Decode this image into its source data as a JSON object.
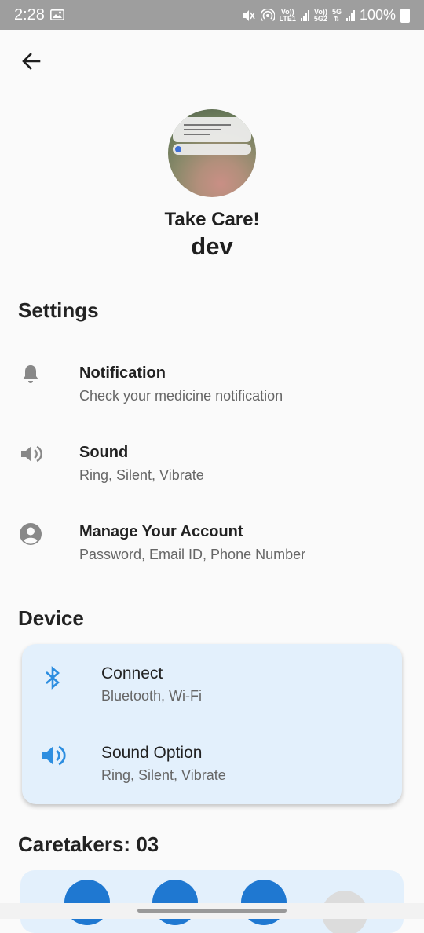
{
  "status_bar": {
    "time": "2:28",
    "volte1": "Vo))",
    "lte1": "LTE1",
    "volte2": "Vo))",
    "lte2": "5G2",
    "net": "5G",
    "battery": "100%"
  },
  "header": {
    "greeting": "Take Care!",
    "username": "dev"
  },
  "settings": {
    "heading": "Settings",
    "items": [
      {
        "label": "Notification",
        "sub": "Check your medicine notification",
        "icon": "bell-icon"
      },
      {
        "label": "Sound",
        "sub": "Ring, Silent, Vibrate",
        "icon": "speaker-icon"
      },
      {
        "label": "Manage Your Account",
        "sub": "Password, Email ID, Phone Number",
        "icon": "account-circle-icon"
      }
    ]
  },
  "device": {
    "heading": "Device",
    "items": [
      {
        "label": "Connect",
        "sub": "Bluetooth, Wi-Fi",
        "icon": "bluetooth-icon"
      },
      {
        "label": "Sound Option",
        "sub": "Ring, Silent, Vibrate",
        "icon": "speaker-icon"
      }
    ]
  },
  "caretakers": {
    "heading": "Caretakers: 03"
  },
  "colors": {
    "accent": "#1f78d1",
    "card_bg": "#e3f0fc",
    "status_bar": "#9e9e9e"
  }
}
